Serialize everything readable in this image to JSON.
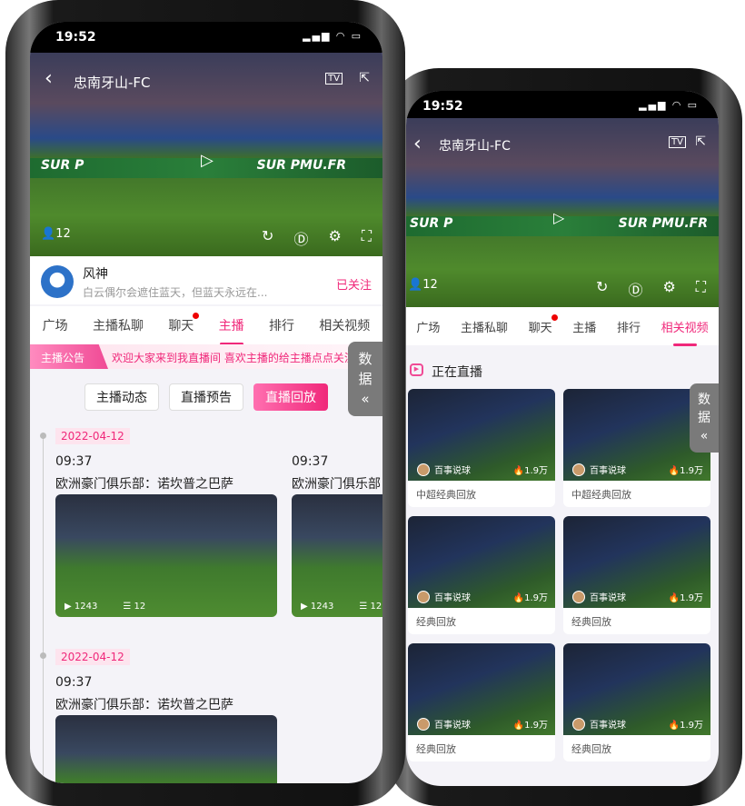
{
  "status": {
    "time": "19:52"
  },
  "video": {
    "title": "忠南牙山-FC",
    "tv_icon": "TV",
    "viewers": "12",
    "ad_left": "SUR P",
    "ad_right": "SUR PMU.FR"
  },
  "anchor": {
    "name": "风神",
    "bio": "白云偶尔会遮住蓝天，但蓝天永远在...",
    "follow": "已关注"
  },
  "tabs": [
    "广场",
    "主播私聊",
    "聊天",
    "主播",
    "排行",
    "相关视频"
  ],
  "notice": {
    "label": "主播公告",
    "text": "欢迎大家来到我直播间 喜欢主播的给主播点点关注"
  },
  "side": {
    "line1": "数",
    "line2": "据",
    "arrow": "«"
  },
  "subtabs": [
    "主播动态",
    "直播预告",
    "直播回放"
  ],
  "timeline": [
    {
      "date": "2022-04-12",
      "time": "09:37",
      "title": "欧洲豪门俱乐部：诺坎普之巴萨",
      "plays": "1243",
      "comments": "12"
    },
    {
      "date": "2022-04-12",
      "time": "09:37",
      "title": "欧洲豪门俱乐部：诺坎普之巴萨",
      "plays": "1243",
      "comments": "12"
    },
    {
      "date": "2022-04-12",
      "time": "09:37",
      "title": "欧洲豪门俱乐部：诺坎普之巴萨"
    }
  ],
  "live": {
    "title": "正在直播",
    "cards": [
      {
        "author": "百事说球",
        "hot": "1.9万",
        "caption": "中超经典回放"
      },
      {
        "author": "百事说球",
        "hot": "1.9万",
        "caption": "中超经典回放"
      },
      {
        "author": "百事说球",
        "hot": "1.9万",
        "caption": "经典回放"
      },
      {
        "author": "百事说球",
        "hot": "1.9万",
        "caption": "经典回放"
      },
      {
        "author": "百事说球",
        "hot": "1.9万",
        "caption": "经典回放"
      },
      {
        "author": "百事说球",
        "hot": "1.9万",
        "caption": "经典回放"
      }
    ]
  },
  "colors": {
    "accent": "#f0287a"
  }
}
